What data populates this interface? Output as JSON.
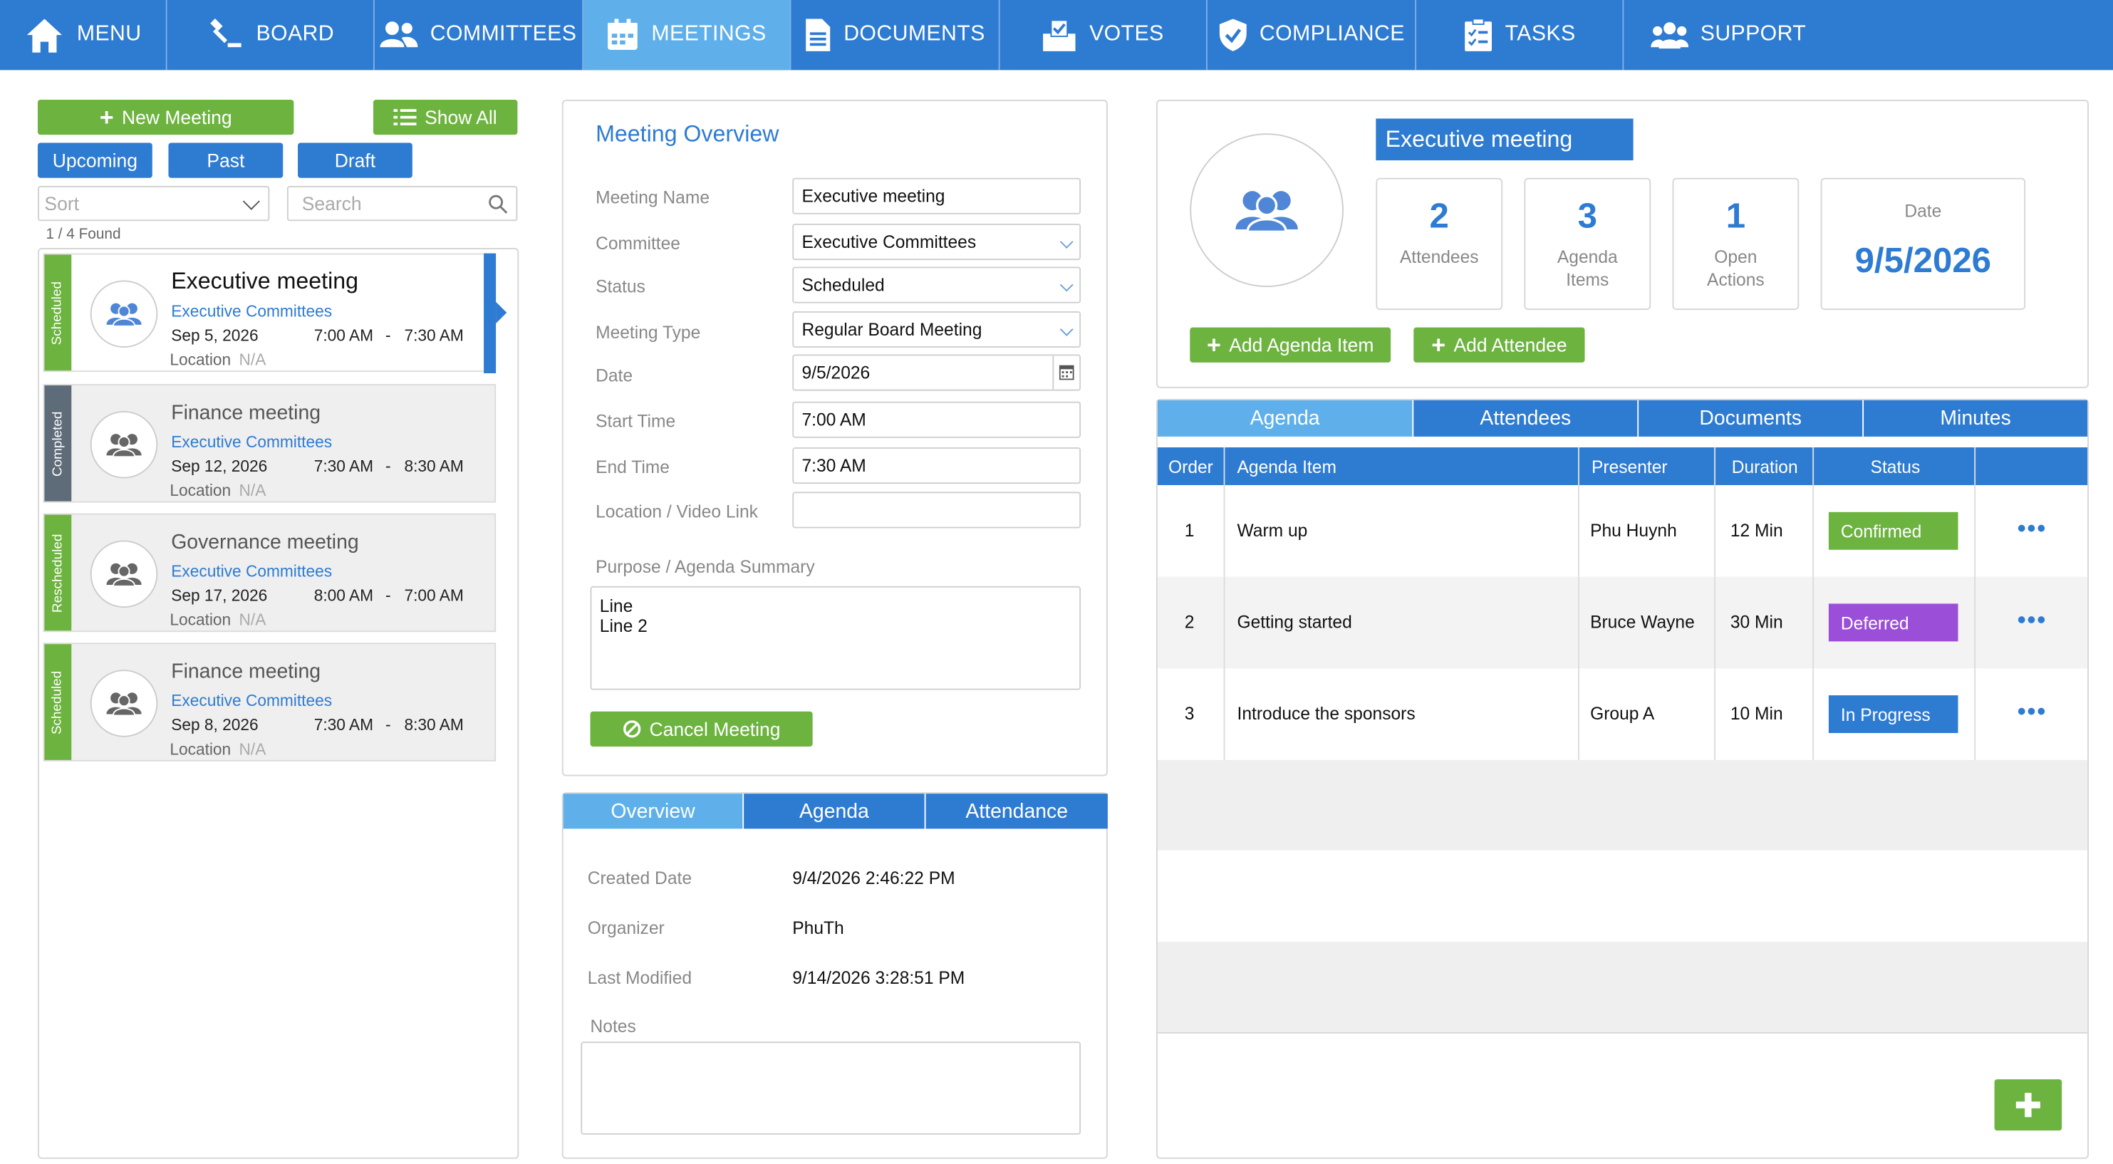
{
  "nav": {
    "items": [
      {
        "label": "MENU",
        "icon": "home-icon"
      },
      {
        "label": "BOARD",
        "icon": "gavel-icon"
      },
      {
        "label": "COMMITTEES",
        "icon": "users-icon"
      },
      {
        "label": "MEETINGS",
        "icon": "calendar-icon"
      },
      {
        "label": "DOCUMENTS",
        "icon": "document-icon"
      },
      {
        "label": "VOTES",
        "icon": "ballot-icon"
      },
      {
        "label": "COMPLIANCE",
        "icon": "shield-check-icon"
      },
      {
        "label": "TASKS",
        "icon": "checklist-icon"
      },
      {
        "label": "SUPPORT",
        "icon": "support-group-icon"
      }
    ],
    "active": "MEETINGS"
  },
  "list": {
    "new_meeting": "New Meeting",
    "show_all": "Show All",
    "filters": [
      "Upcoming",
      "Past",
      "Draft"
    ],
    "sort_placeholder": "Sort",
    "search_placeholder": "Search",
    "found": "1 / 4 Found",
    "location_label": "Location",
    "meetings": [
      {
        "title": "Executive meeting",
        "committee": "Executive Committees",
        "date": "Sep 5, 2026",
        "start": "7:00 AM",
        "sep": "-",
        "end": "7:30 AM",
        "location": "N/A",
        "status": "Scheduled"
      },
      {
        "title": "Finance meeting",
        "committee": "Executive Committees",
        "date": "Sep 12, 2026",
        "start": "7:30 AM",
        "sep": "-",
        "end": "8:30 AM",
        "location": "N/A",
        "status": "Completed"
      },
      {
        "title": "Governance meeting",
        "committee": "Executive Committees",
        "date": "Sep 17, 2026",
        "start": "8:00 AM",
        "sep": "-",
        "end": "7:00 AM",
        "location": "N/A",
        "status": "Rescheduled"
      },
      {
        "title": "Finance meeting",
        "committee": "Executive Committees",
        "date": "Sep 8, 2026",
        "start": "7:30 AM",
        "sep": "-",
        "end": "8:30 AM",
        "location": "N/A",
        "status": "Scheduled"
      }
    ]
  },
  "overview": {
    "heading": "Meeting Overview",
    "fields": {
      "name_label": "Meeting Name",
      "name": "Executive meeting",
      "committee_label": "Committee",
      "committee": "Executive Committees",
      "status_label": "Status",
      "status": "Scheduled",
      "type_label": "Meeting Type",
      "type": "Regular Board Meeting",
      "date_label": "Date",
      "date": "9/5/2026",
      "start_label": "Start Time",
      "start": "7:00 AM",
      "end_label": "End Time",
      "end": "7:30 AM",
      "location_label": "Location / Video Link",
      "location": ""
    },
    "purpose_label": "Purpose / Agenda Summary",
    "purpose_line1": "Line",
    "purpose_line2": "Line 2",
    "cancel": "Cancel Meeting"
  },
  "detail_tabs": [
    "Overview",
    "Agenda",
    "Attendance"
  ],
  "detail": {
    "created_label": "Created Date",
    "created": "9/4/2026 2:46:22 PM",
    "organizer_label": "Organizer",
    "organizer": "PhuTh",
    "modified_label": "Last Modified",
    "modified": "9/14/2026 3:28:51 PM",
    "notes_label": "Notes"
  },
  "summary": {
    "title": "Executive meeting",
    "attendees": "2",
    "attendees_label": "Attendees",
    "agenda_items": "3",
    "agenda_label_1": "Agenda",
    "agenda_label_2": "Items",
    "open_actions": "1",
    "open_label_1": "Open",
    "open_label_2": "Actions",
    "date_label": "Date",
    "date": "9/5/2026",
    "add_agenda": "Add Agenda Item",
    "add_attendee": "Add Attendee"
  },
  "right_tabs": [
    "Agenda",
    "Attendees",
    "Documents",
    "Minutes"
  ],
  "agenda_table": {
    "headers": [
      "Order",
      "Agenda Item",
      "Presenter",
      "Duration",
      "Status"
    ],
    "rows": [
      {
        "order": "1",
        "item": "Warm up",
        "presenter": "Phu Huynh",
        "duration": "12 Min",
        "status": "Confirmed",
        "color": "#6db33f"
      },
      {
        "order": "2",
        "item": "Getting started",
        "presenter": "Bruce Wayne",
        "duration": "30 Min",
        "status": "Deferred",
        "color": "#9b4fd8"
      },
      {
        "order": "3",
        "item": "Introduce the sponsors",
        "presenter": "Group A",
        "duration": "10 Min",
        "status": "In Progress",
        "color": "#2e7bd2"
      }
    ]
  },
  "colors": {
    "primary": "#2e7bd2",
    "active_tab": "#5fb0ea",
    "green": "#6db33f",
    "completed_stripe": "#5e6b78"
  }
}
